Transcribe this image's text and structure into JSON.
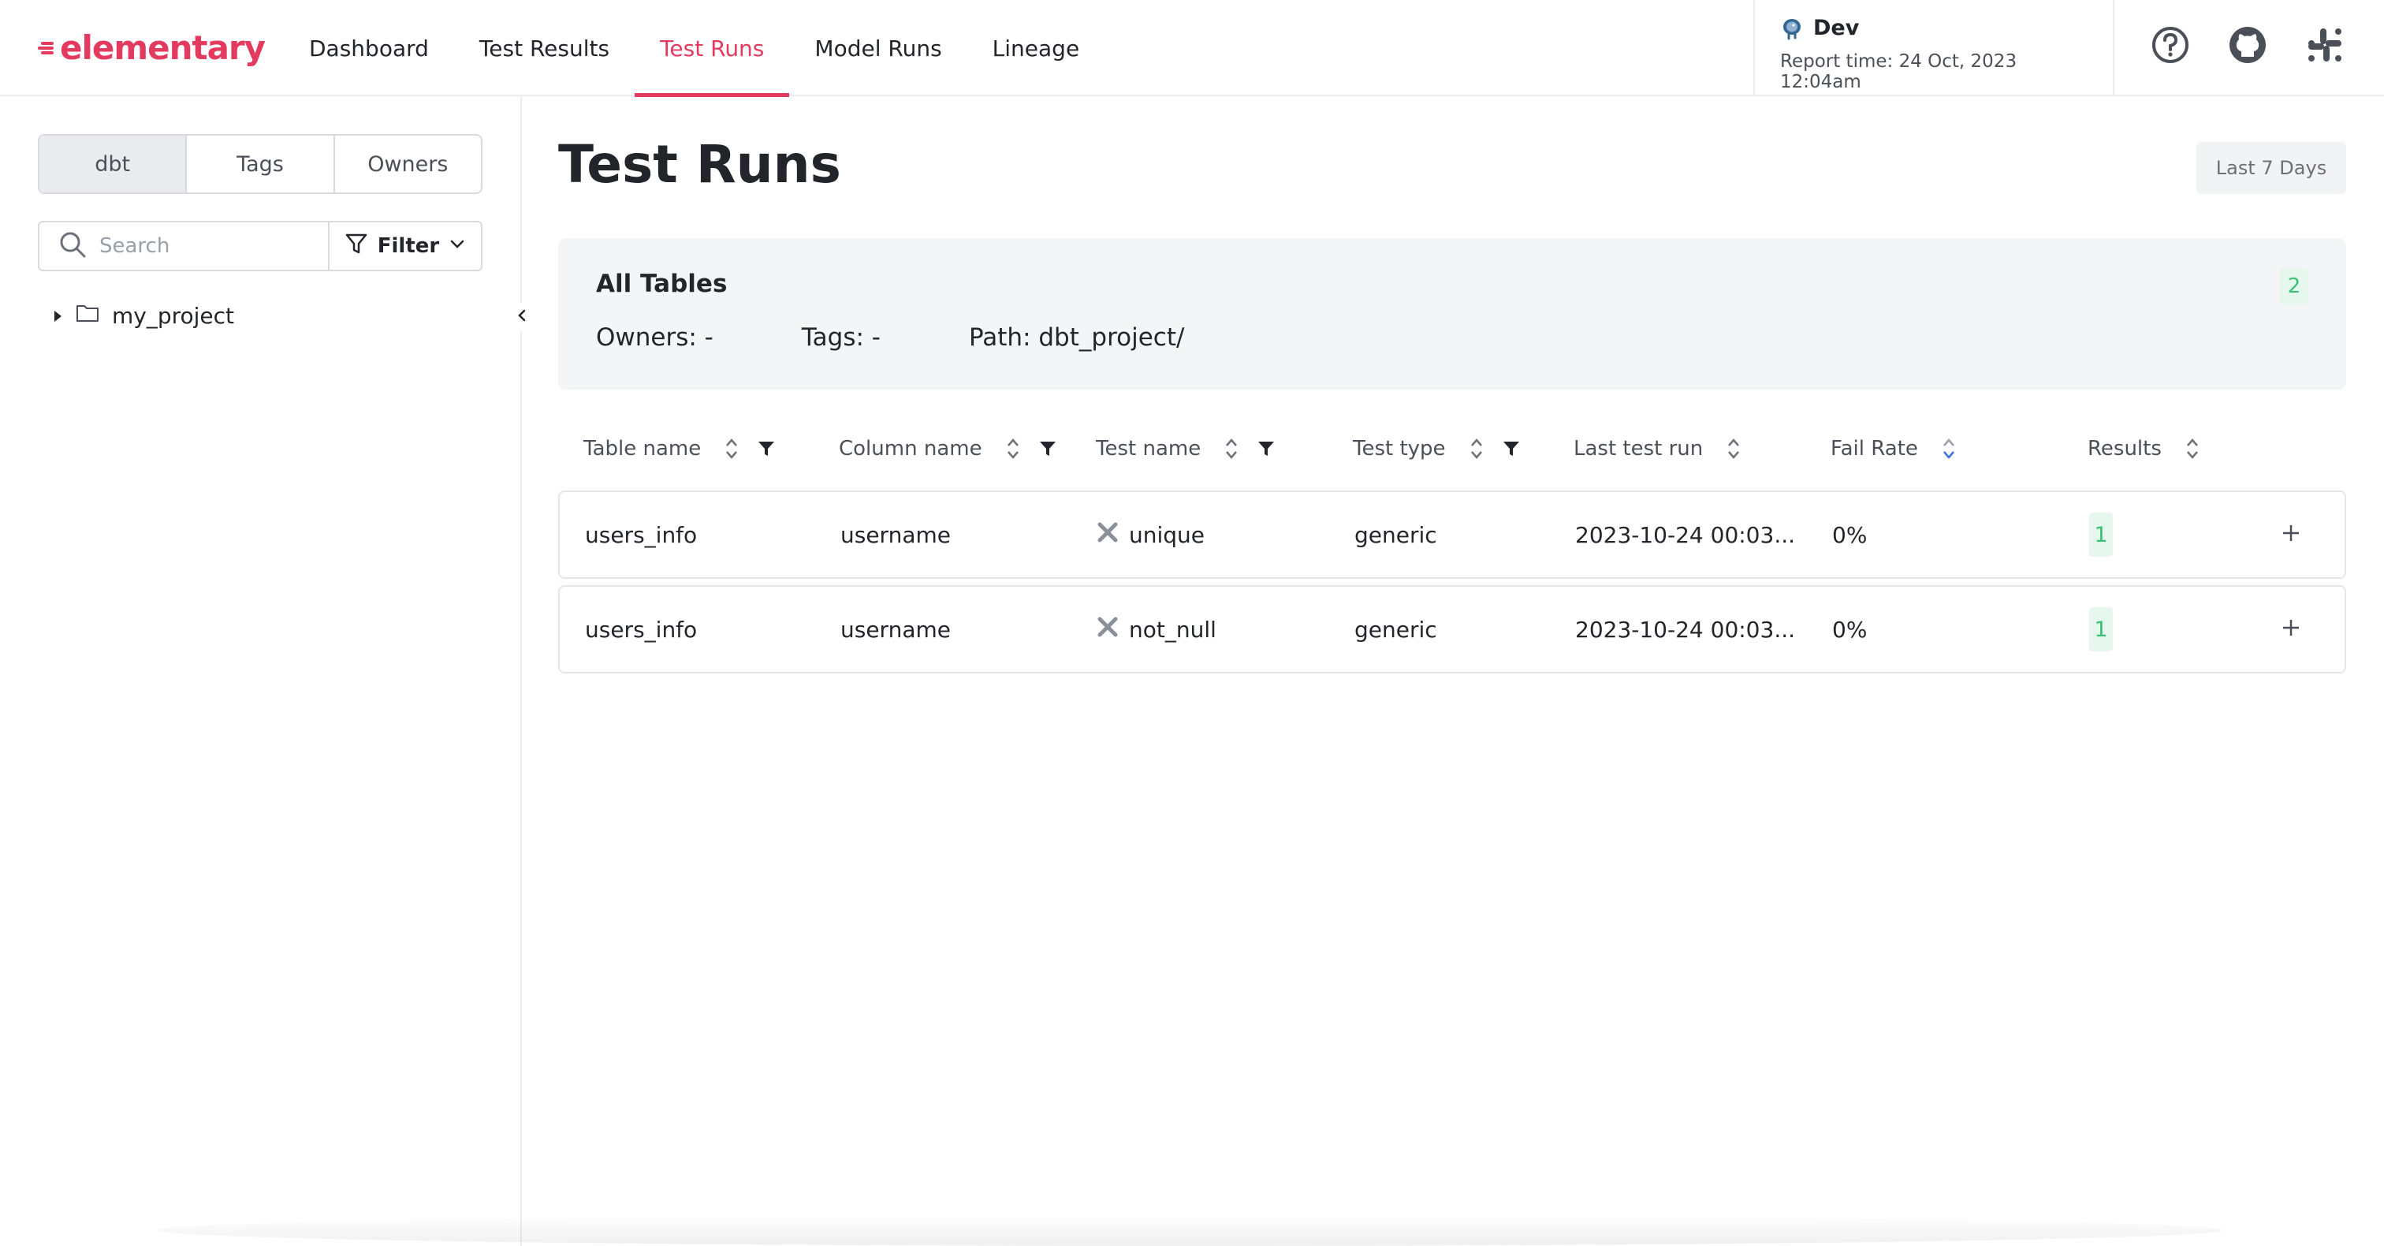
{
  "brand": {
    "name": "elementary",
    "color": "#e33b5f"
  },
  "nav": {
    "items": [
      {
        "label": "Dashboard"
      },
      {
        "label": "Test Results"
      },
      {
        "label": "Test Runs",
        "active": true
      },
      {
        "label": "Model Runs"
      },
      {
        "label": "Lineage"
      }
    ]
  },
  "env": {
    "name": "Dev",
    "report_time": "Report time: 24 Oct, 2023 12:04am",
    "icon": "postgres-elephant-icon"
  },
  "header_icons": [
    "help-icon",
    "github-icon",
    "slack-icon"
  ],
  "sidebar": {
    "segments": [
      "dbt",
      "Tags",
      "Owners"
    ],
    "active_segment": "dbt",
    "search": {
      "placeholder": "Search",
      "value": ""
    },
    "filter_label": "Filter",
    "tree": [
      {
        "label": "my_project",
        "type": "folder",
        "expanded": false
      }
    ]
  },
  "main": {
    "title": "Test Runs",
    "range_label": "Last 7 Days",
    "summary": {
      "title": "All Tables",
      "count": "2",
      "owners": "Owners: -",
      "tags": "Tags: -",
      "path": "Path: dbt_project/"
    },
    "columns": [
      "Table name",
      "Column name",
      "Test name",
      "Test type",
      "Last test run",
      "Fail Rate",
      "Results"
    ],
    "rows": [
      {
        "table": "users_info",
        "column": "username",
        "test": "unique",
        "type": "generic",
        "last_run": "2023-10-24 00:03...",
        "fail_rate": "0%",
        "results": "1"
      },
      {
        "table": "users_info",
        "column": "username",
        "test": "not_null",
        "type": "generic",
        "last_run": "2023-10-24 00:03...",
        "fail_rate": "0%",
        "results": "1"
      }
    ]
  },
  "colors": {
    "accent": "#e33b5f",
    "success": "#3dbf7a",
    "sort_active": "#3b6fe0"
  }
}
